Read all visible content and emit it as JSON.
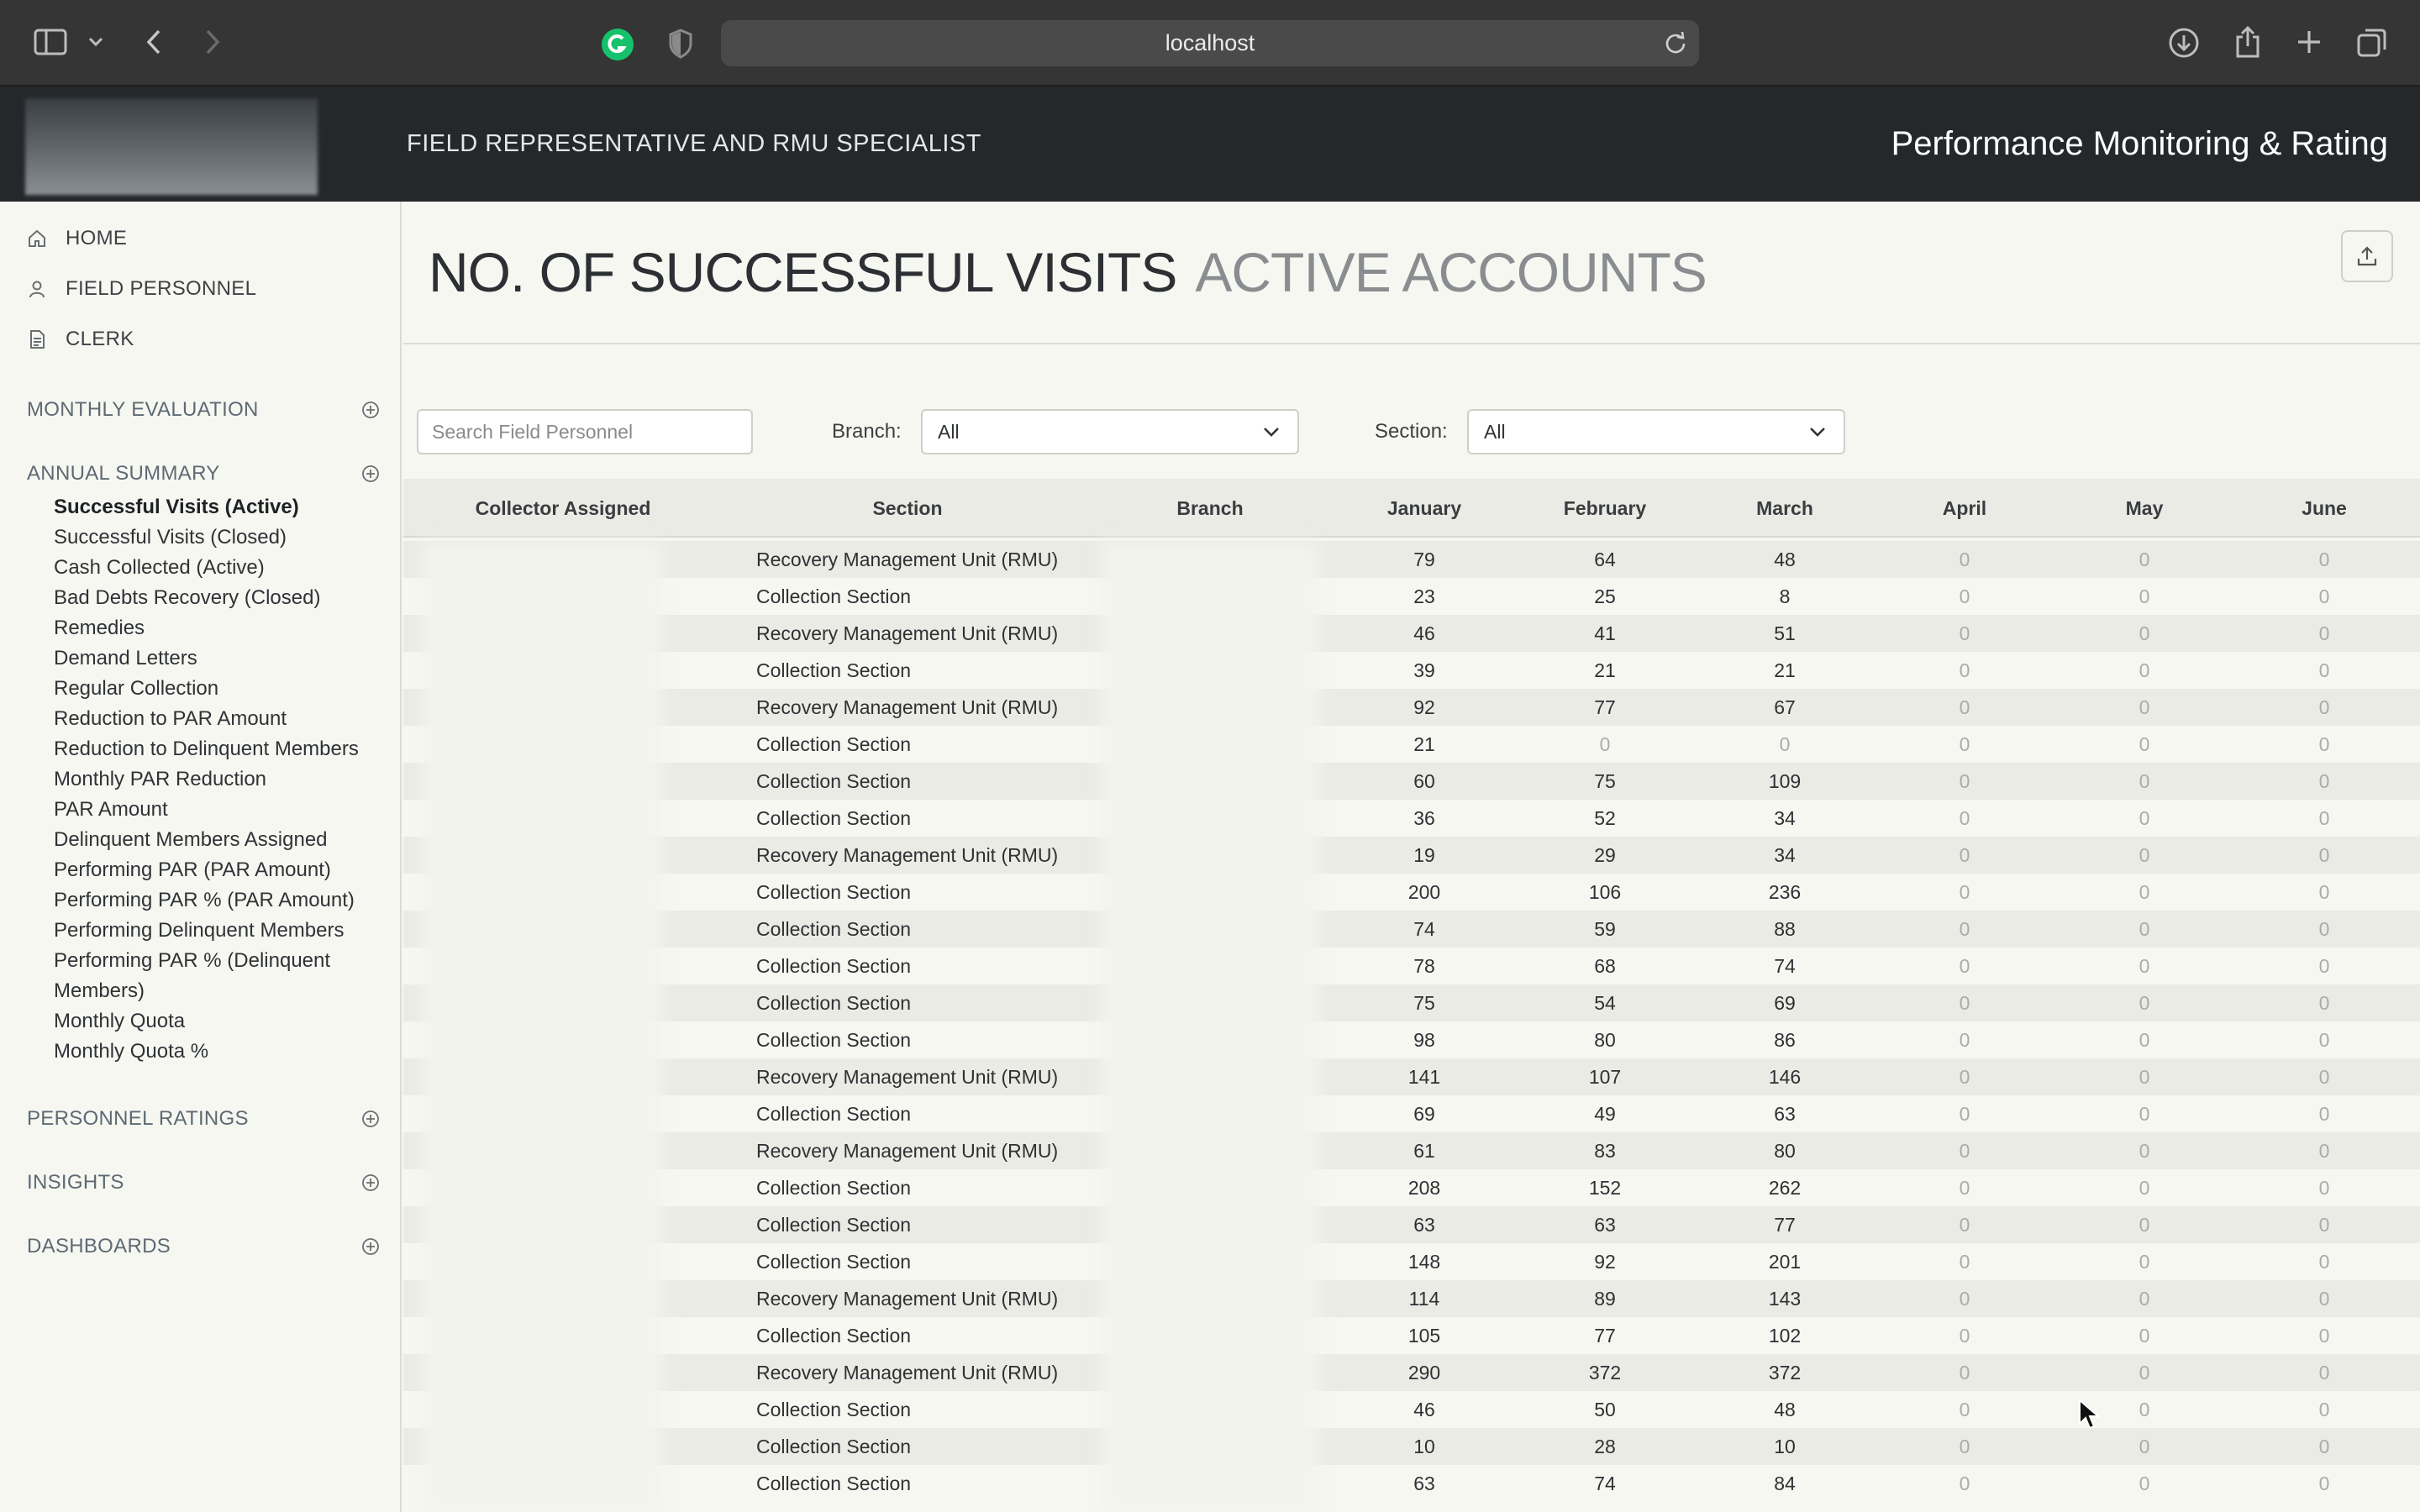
{
  "browser": {
    "url": "localhost",
    "icons": [
      "sidebar-toggle-icon",
      "chevron-down-icon",
      "back-icon",
      "forward-icon",
      "grammarly-icon",
      "privacy-shield-icon",
      "reload-icon",
      "download-icon",
      "share-icon",
      "new-tab-icon",
      "tabs-overview-icon"
    ]
  },
  "header": {
    "subtitle": "FIELD REPRESENTATIVE AND RMU SPECIALIST",
    "title": "Performance Monitoring & Rating"
  },
  "sidebar": {
    "top_links": [
      {
        "label": "HOME",
        "icon": "home-icon"
      },
      {
        "label": "FIELD PERSONNEL",
        "icon": "person-icon"
      },
      {
        "label": "CLERK",
        "icon": "document-icon"
      }
    ],
    "monthly_evaluation": "MONTHLY EVALUATION",
    "annual_summary": "ANNUAL SUMMARY",
    "annual_items": [
      "Successful Visits (Active)",
      "Successful Visits (Closed)",
      "Cash Collected (Active)",
      "Bad Debts Recovery (Closed)",
      "Remedies",
      "Demand Letters",
      "Regular Collection",
      "Reduction to PAR Amount",
      "Reduction to Delinquent Members",
      "Monthly PAR Reduction",
      "PAR Amount",
      "Delinquent Members Assigned",
      "Performing PAR (PAR Amount)",
      "Performing PAR % (PAR Amount)",
      "Performing Delinquent Members",
      "Performing PAR % (Delinquent",
      "Members)",
      "Monthly Quota",
      "Monthly Quota %"
    ],
    "active_item": "Successful Visits (Active)",
    "personnel_ratings": "PERSONNEL RATINGS",
    "insights": "INSIGHTS",
    "dashboards": "DASHBOARDS"
  },
  "page": {
    "title": "NO. OF SUCCESSFUL VISITS",
    "subtitle": "ACTIVE ACCOUNTS"
  },
  "filters": {
    "search_placeholder": "Search Field Personnel",
    "branch_label": "Branch:",
    "branch_value": "All",
    "section_label": "Section:",
    "section_value": "All"
  },
  "table": {
    "columns": [
      "Collector Assigned",
      "Section",
      "Branch",
      "January",
      "February",
      "March",
      "April",
      "May",
      "June"
    ],
    "rows": [
      [
        "Recovery Management Unit (RMU)",
        "79",
        "64",
        "48",
        "0",
        "0",
        "0"
      ],
      [
        "Collection Section",
        "23",
        "25",
        "8",
        "0",
        "0",
        "0"
      ],
      [
        "Recovery Management Unit (RMU)",
        "46",
        "41",
        "51",
        "0",
        "0",
        "0"
      ],
      [
        "Collection Section",
        "39",
        "21",
        "21",
        "0",
        "0",
        "0"
      ],
      [
        "Recovery Management Unit (RMU)",
        "92",
        "77",
        "67",
        "0",
        "0",
        "0"
      ],
      [
        "Collection Section",
        "21",
        "0",
        "0",
        "0",
        "0",
        "0"
      ],
      [
        "Collection Section",
        "60",
        "75",
        "109",
        "0",
        "0",
        "0"
      ],
      [
        "Collection Section",
        "36",
        "52",
        "34",
        "0",
        "0",
        "0"
      ],
      [
        "Recovery Management Unit (RMU)",
        "19",
        "29",
        "34",
        "0",
        "0",
        "0"
      ],
      [
        "Collection Section",
        "200",
        "106",
        "236",
        "0",
        "0",
        "0"
      ],
      [
        "Collection Section",
        "74",
        "59",
        "88",
        "0",
        "0",
        "0"
      ],
      [
        "Collection Section",
        "78",
        "68",
        "74",
        "0",
        "0",
        "0"
      ],
      [
        "Collection Section",
        "75",
        "54",
        "69",
        "0",
        "0",
        "0"
      ],
      [
        "Collection Section",
        "98",
        "80",
        "86",
        "0",
        "0",
        "0"
      ],
      [
        "Recovery Management Unit (RMU)",
        "141",
        "107",
        "146",
        "0",
        "0",
        "0"
      ],
      [
        "Collection Section",
        "69",
        "49",
        "63",
        "0",
        "0",
        "0"
      ],
      [
        "Recovery Management Unit (RMU)",
        "61",
        "83",
        "80",
        "0",
        "0",
        "0"
      ],
      [
        "Collection Section",
        "208",
        "152",
        "262",
        "0",
        "0",
        "0"
      ],
      [
        "Collection Section",
        "63",
        "63",
        "77",
        "0",
        "0",
        "0"
      ],
      [
        "Collection Section",
        "148",
        "92",
        "201",
        "0",
        "0",
        "0"
      ],
      [
        "Recovery Management Unit (RMU)",
        "114",
        "89",
        "143",
        "0",
        "0",
        "0"
      ],
      [
        "Collection Section",
        "105",
        "77",
        "102",
        "0",
        "0",
        "0"
      ],
      [
        "Recovery Management Unit (RMU)",
        "290",
        "372",
        "372",
        "0",
        "0",
        "0"
      ],
      [
        "Collection Section",
        "46",
        "50",
        "48",
        "0",
        "0",
        "0"
      ],
      [
        "Collection Section",
        "10",
        "28",
        "10",
        "0",
        "0",
        "0"
      ],
      [
        "Collection Section",
        "63",
        "74",
        "84",
        "0",
        "0",
        "0"
      ]
    ]
  }
}
